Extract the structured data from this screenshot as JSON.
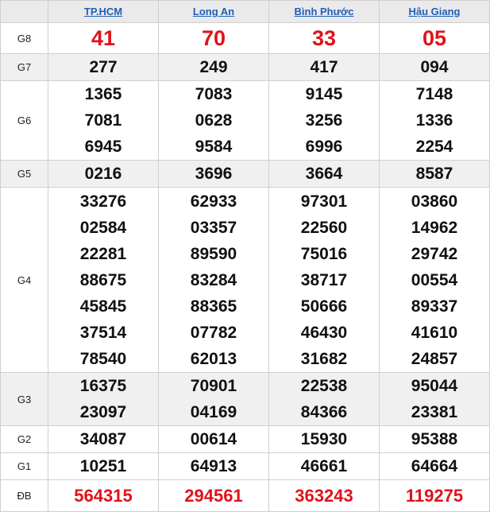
{
  "provinces": [
    "TP.HCM",
    "Long An",
    "Bình Phước",
    "Hậu Giang"
  ],
  "colors": {
    "accent_red": "#e0121b",
    "link_blue": "#1f5fb8",
    "shaded_row": "#f0f0f0",
    "header_bg": "#eaeaea"
  },
  "prizes": {
    "G8": {
      "label": "G8",
      "values": [
        [
          "41"
        ],
        [
          "70"
        ],
        [
          "33"
        ],
        [
          "05"
        ]
      ]
    },
    "G7": {
      "label": "G7",
      "values": [
        [
          "277"
        ],
        [
          "249"
        ],
        [
          "417"
        ],
        [
          "094"
        ]
      ]
    },
    "G6": {
      "label": "G6",
      "values": [
        [
          "1365",
          "7081",
          "6945"
        ],
        [
          "7083",
          "0628",
          "9584"
        ],
        [
          "9145",
          "3256",
          "6996"
        ],
        [
          "7148",
          "1336",
          "2254"
        ]
      ]
    },
    "G5": {
      "label": "G5",
      "values": [
        [
          "0216"
        ],
        [
          "3696"
        ],
        [
          "3664"
        ],
        [
          "8587"
        ]
      ]
    },
    "G4": {
      "label": "G4",
      "values": [
        [
          "33276",
          "02584",
          "22281",
          "88675",
          "45845",
          "37514",
          "78540"
        ],
        [
          "62933",
          "03357",
          "89590",
          "83284",
          "88365",
          "07782",
          "62013"
        ],
        [
          "97301",
          "22560",
          "75016",
          "38717",
          "50666",
          "46430",
          "31682"
        ],
        [
          "03860",
          "14962",
          "29742",
          "00554",
          "89337",
          "41610",
          "24857"
        ]
      ]
    },
    "G3": {
      "label": "G3",
      "values": [
        [
          "16375",
          "23097"
        ],
        [
          "70901",
          "04169"
        ],
        [
          "22538",
          "84366"
        ],
        [
          "95044",
          "23381"
        ]
      ]
    },
    "G2": {
      "label": "G2",
      "values": [
        [
          "34087"
        ],
        [
          "00614"
        ],
        [
          "15930"
        ],
        [
          "95388"
        ]
      ]
    },
    "G1": {
      "label": "G1",
      "values": [
        [
          "10251"
        ],
        [
          "64913"
        ],
        [
          "46661"
        ],
        [
          "64664"
        ]
      ]
    },
    "DB": {
      "label": "ĐB",
      "values": [
        [
          "564315"
        ],
        [
          "294561"
        ],
        [
          "363243"
        ],
        [
          "119275"
        ]
      ]
    }
  }
}
